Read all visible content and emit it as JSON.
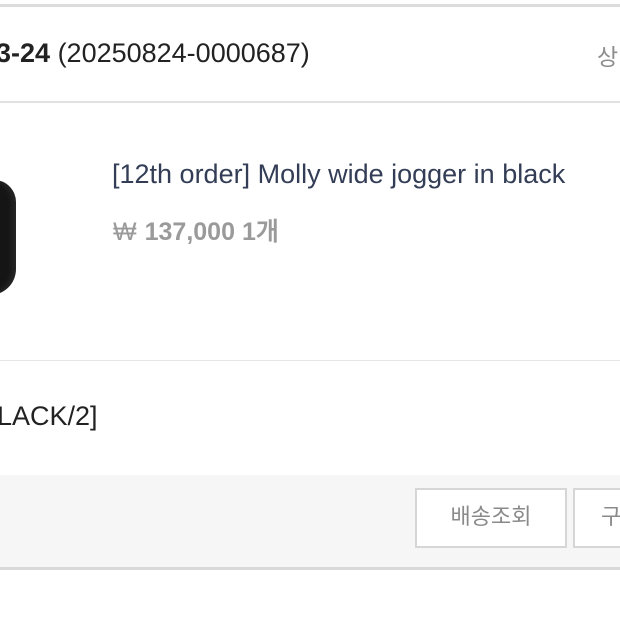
{
  "order": {
    "date_partial": "3-24",
    "number": "(20250824-0000687)",
    "status_partial": "상"
  },
  "product": {
    "name": "[12th order] Molly wide jogger in black",
    "currency": "₩",
    "price": "137,000",
    "quantity": "1개",
    "image_icon": "black-jogger-thumbnail"
  },
  "option": {
    "text": "LACK/2]"
  },
  "actions": {
    "track_label": "배송조회",
    "second_label_partial": "구"
  }
}
